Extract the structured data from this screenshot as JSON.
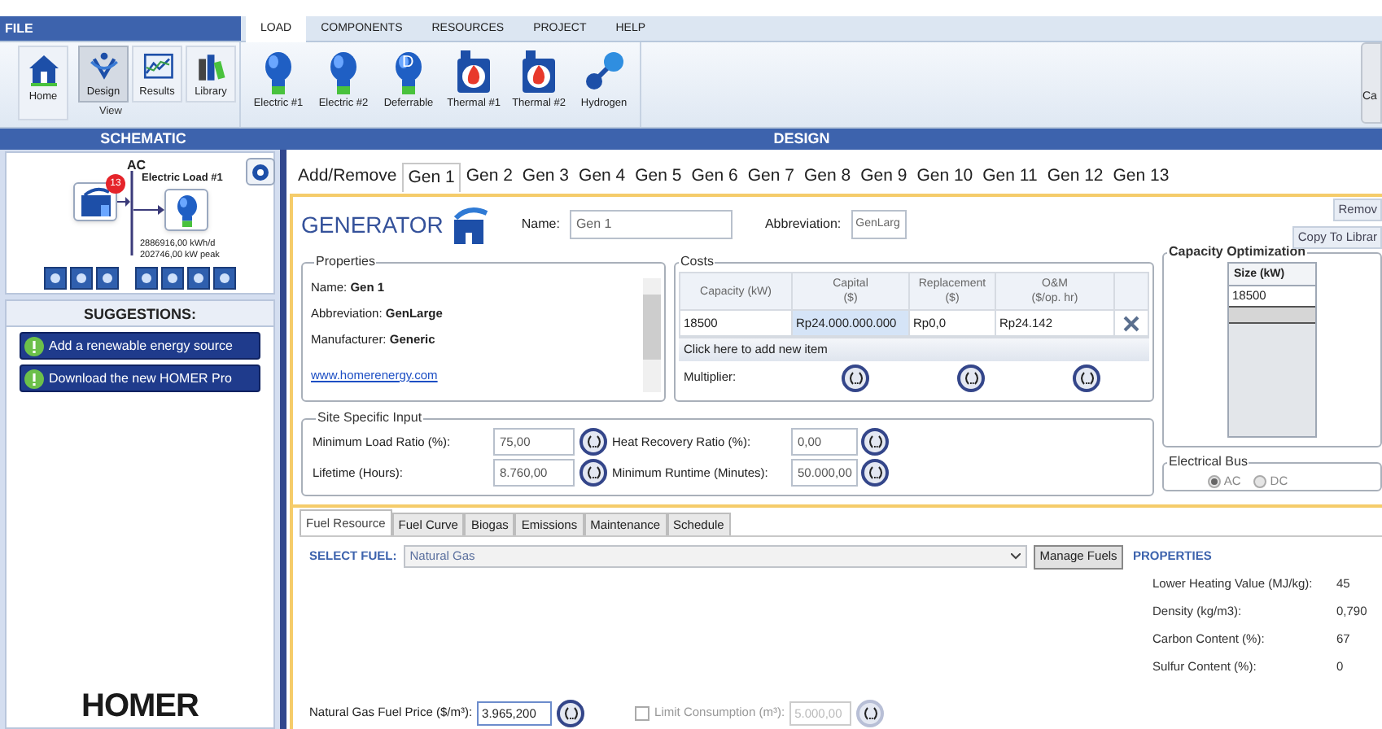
{
  "menu": {
    "file": "FILE",
    "tabs": [
      {
        "label": "LOAD",
        "selected": true
      },
      {
        "label": "COMPONENTS",
        "selected": false
      },
      {
        "label": "RESOURCES",
        "selected": false
      },
      {
        "label": "PROJECT",
        "selected": false
      },
      {
        "label": "HELP",
        "selected": false
      }
    ]
  },
  "ribbon": {
    "view_buttons": [
      {
        "label": "Home",
        "kind": "home",
        "selected": false
      },
      {
        "label": "Design",
        "kind": "design",
        "selected": true
      },
      {
        "label": "Results",
        "kind": "results",
        "selected": false
      },
      {
        "label": "Library",
        "kind": "library",
        "selected": false
      }
    ],
    "view_group_label": "View",
    "load_buttons": [
      {
        "label": "Electric #1",
        "kind": "bulb"
      },
      {
        "label": "Electric #2",
        "kind": "bulb"
      },
      {
        "label": "Deferrable",
        "kind": "deferrable",
        "icon_letter": "D"
      },
      {
        "label": "Thermal #1",
        "kind": "thermal"
      },
      {
        "label": "Thermal #2",
        "kind": "thermal"
      },
      {
        "label": "Hydrogen",
        "kind": "hydrogen"
      }
    ],
    "right_button": "Ca"
  },
  "schematic": {
    "header": "SCHEMATIC",
    "bus": "AC",
    "badge": "13",
    "load_name": "Electric Load #1",
    "load_stats": [
      "2886916,00 kWh/d",
      "202746,00 kW peak"
    ]
  },
  "suggestions": {
    "title": "SUGGESTIONS:",
    "items": [
      "Add a renewable energy source",
      "Download the new HOMER Pro"
    ]
  },
  "logo": "HOMER",
  "design": {
    "header": "DESIGN",
    "tabs": [
      {
        "label": "Add/Remove",
        "selected": false
      },
      {
        "label": "Gen 1",
        "selected": true
      },
      {
        "label": "Gen 2",
        "selected": false
      },
      {
        "label": "Gen 3",
        "selected": false
      },
      {
        "label": "Gen 4",
        "selected": false
      },
      {
        "label": "Gen 5",
        "selected": false
      },
      {
        "label": "Gen 6",
        "selected": false
      },
      {
        "label": "Gen 7",
        "selected": false
      },
      {
        "label": "Gen 8",
        "selected": false
      },
      {
        "label": "Gen 9",
        "selected": false
      },
      {
        "label": "Gen 10",
        "selected": false
      },
      {
        "label": "Gen 11",
        "selected": false
      },
      {
        "label": "Gen 12",
        "selected": false
      },
      {
        "label": "Gen 13",
        "selected": false
      }
    ]
  },
  "generator": {
    "title": "GENERATOR",
    "name_label": "Name:",
    "name_value": "Gen 1",
    "abbr_label": "Abbreviation:",
    "abbr_value": "GenLarg",
    "buttons": [
      "Remov",
      "Copy To Librar"
    ],
    "properties": {
      "legend": "Properties",
      "lines": [
        {
          "label": "Name:",
          "value": "Gen 1"
        },
        {
          "label": "Abbreviation:",
          "value": "GenLarge"
        },
        {
          "label": "Manufacturer:",
          "value": "Generic"
        }
      ],
      "link": "www.homerenergy.com"
    },
    "costs": {
      "legend": "Costs",
      "columns": [
        {
          "title": "Capacity (kW)"
        },
        {
          "title": "Capital",
          "unit": "($)"
        },
        {
          "title": "Replacement",
          "unit": "($)"
        },
        {
          "title": "O&M",
          "unit": "($/op. hr)"
        }
      ],
      "rows": [
        [
          "18500",
          "Rp24.000.000.000",
          "Rp0,0",
          "Rp24.142"
        ]
      ],
      "add_row": "Click here to add new item",
      "multiplier_label": "Multiplier:"
    },
    "capacity_optimization": {
      "legend": "Capacity Optimization",
      "column": "Size (kW)",
      "values": [
        "18500"
      ]
    },
    "site_input": {
      "legend": "Site Specific Input",
      "fields": [
        {
          "label": "Minimum Load Ratio (%):",
          "value": "75,00"
        },
        {
          "label": "Heat Recovery Ratio (%):",
          "value": "0,00"
        },
        {
          "label": "Lifetime (Hours):",
          "value": "8.760,00"
        },
        {
          "label": "Minimum Runtime (Minutes):",
          "value": "50.000,00"
        }
      ]
    },
    "electrical_bus": {
      "legend": "Electrical Bus",
      "options": [
        {
          "label": "AC",
          "selected": true
        },
        {
          "label": "DC",
          "selected": false
        }
      ]
    }
  },
  "fuel_tabs": [
    {
      "label": "Fuel Resource",
      "selected": true
    },
    {
      "label": "Fuel Curve",
      "selected": false
    },
    {
      "label": "Biogas",
      "selected": false
    },
    {
      "label": "Emissions",
      "selected": false
    },
    {
      "label": "Maintenance",
      "selected": false
    },
    {
      "label": "Schedule",
      "selected": false
    }
  ],
  "fuel": {
    "select_label": "SELECT FUEL:",
    "selected_fuel": "Natural Gas",
    "manage_button": "Manage Fuels",
    "properties_title": "PROPERTIES",
    "properties": [
      {
        "label": "Lower Heating Value (MJ/kg):",
        "value": "45"
      },
      {
        "label": "Density (kg/m3):",
        "value": "0,790"
      },
      {
        "label": "Carbon Content (%):",
        "value": "67"
      },
      {
        "label": "Sulfur Content (%):",
        "value": "0"
      }
    ],
    "price_label": "Natural Gas Fuel Price ($/m³):",
    "price_value": "3.965,200",
    "limit": {
      "label": "Limit Consumption (m³):",
      "checked": false,
      "disabled": true,
      "value": "5.000,00"
    }
  }
}
